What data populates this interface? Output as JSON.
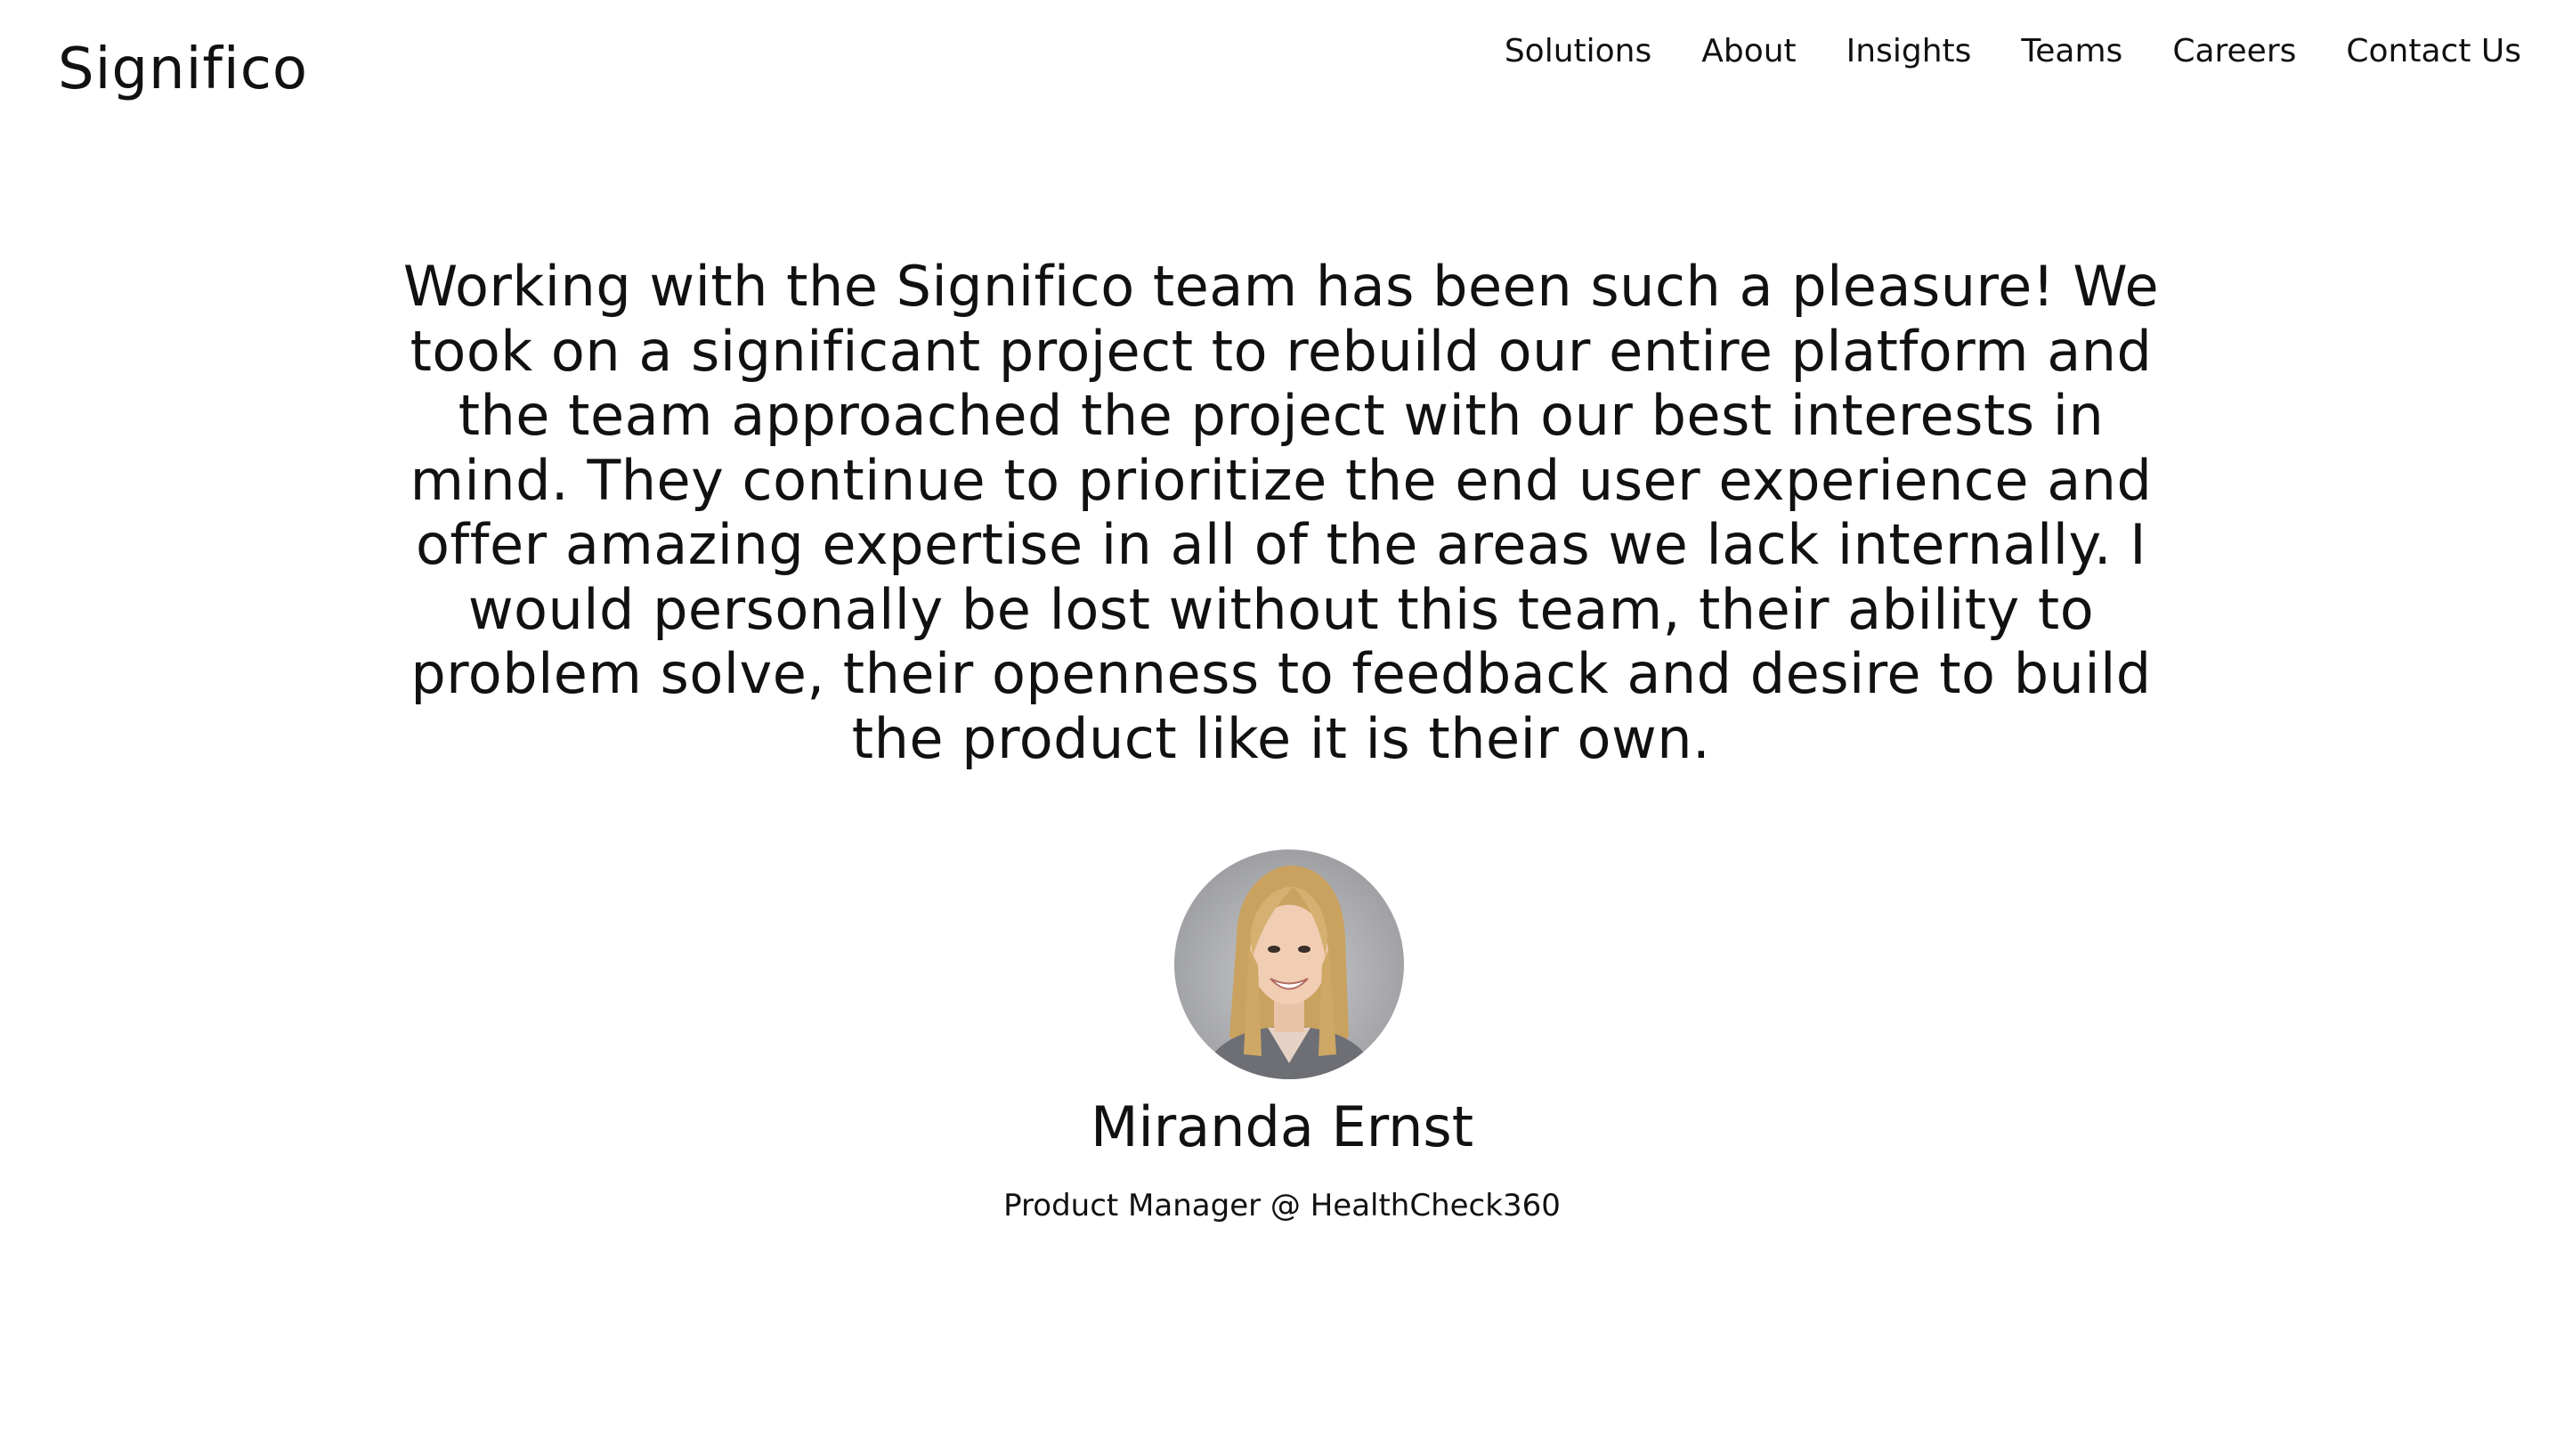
{
  "brand": {
    "logo_text": "Significo"
  },
  "nav": {
    "items": [
      {
        "label": "Solutions"
      },
      {
        "label": "About"
      },
      {
        "label": "Insights"
      },
      {
        "label": "Teams"
      },
      {
        "label": "Careers"
      },
      {
        "label": "Contact Us"
      }
    ]
  },
  "testimonial": {
    "quote": "Working with the Significo team has been such a pleasure! We took on a significant project to rebuild our entire platform and the team approached the project with our best interests in mind. They continue to prioritize the end user experience and offer amazing expertise in all of the areas we lack internally. I would personally be lost without this team, their ability to problem solve, their openness to feedback and desire to build the product like it is their own.",
    "name": "Miranda Ernst",
    "role": "Product Manager @ HealthCheck360"
  },
  "colors": {
    "background": "#ffffff",
    "text": "#111111"
  }
}
